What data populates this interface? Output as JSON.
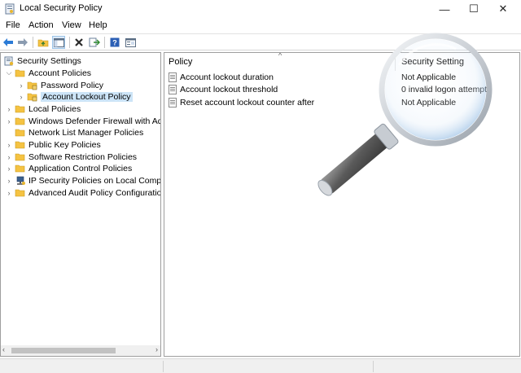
{
  "window": {
    "title": "Local Security Policy",
    "controls": {
      "minimize": "—",
      "maximize": "☐",
      "close": "✕"
    }
  },
  "menubar": {
    "items": [
      "File",
      "Action",
      "View",
      "Help"
    ]
  },
  "toolbar": {
    "buttons": [
      "back-arrow-icon",
      "forward-arrow-icon",
      "up-folder-icon",
      "show-hide-tree-icon",
      "delete-icon",
      "export-list-icon",
      "help-icon",
      "properties-icon"
    ]
  },
  "tree": {
    "root": "Security Settings",
    "items": [
      {
        "label": "Account Policies",
        "level": 1,
        "expanded": true
      },
      {
        "label": "Password Policy",
        "level": 2,
        "expanded": false
      },
      {
        "label": "Account Lockout Policy",
        "level": 2,
        "expanded": false,
        "selected": true
      },
      {
        "label": "Local Policies",
        "level": 1,
        "expanded": false
      },
      {
        "label": "Windows Defender Firewall with Adva",
        "level": 1,
        "expanded": false
      },
      {
        "label": "Network List Manager Policies",
        "level": 1,
        "expanded": false
      },
      {
        "label": "Public Key Policies",
        "level": 1,
        "expanded": false
      },
      {
        "label": "Software Restriction Policies",
        "level": 1,
        "expanded": false
      },
      {
        "label": "Application Control Policies",
        "level": 1,
        "expanded": false
      },
      {
        "label": "IP Security Policies on Local Compute",
        "level": 1,
        "expanded": false
      },
      {
        "label": "Advanced Audit Policy Configuration",
        "level": 1,
        "expanded": false
      }
    ]
  },
  "list": {
    "headers": {
      "policy": "Policy",
      "setting": "Security Setting"
    },
    "rows": [
      {
        "policy": "Account lockout duration",
        "setting": "Not Applicable"
      },
      {
        "policy": "Account lockout threshold",
        "setting": "0 invalid logon attempt"
      },
      {
        "policy": "Reset account lockout counter after",
        "setting": "Not Applicable"
      }
    ]
  },
  "colors": {
    "selection": "#cce4f7",
    "folder": "#f5c342",
    "accent": "#2b6cb5"
  }
}
